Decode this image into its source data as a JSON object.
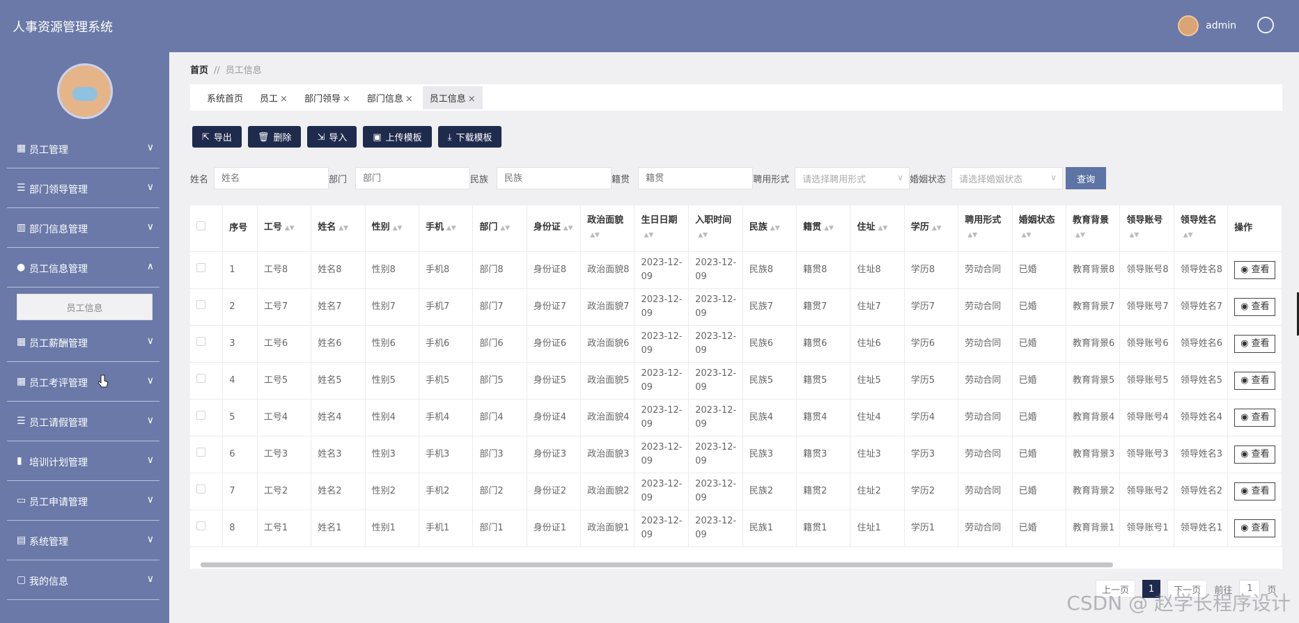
{
  "app": {
    "title": "人事资源管理系统",
    "user": "admin"
  },
  "sidebar": {
    "items": [
      {
        "label": "员工管理",
        "icon": "grid-icon"
      },
      {
        "label": "部门领导管理",
        "icon": "list-icon"
      },
      {
        "label": "部门信息管理",
        "icon": "columns-icon"
      },
      {
        "label": "员工信息管理",
        "icon": "location-icon",
        "expanded": true
      },
      {
        "label": "员工薪酬管理",
        "icon": "grid-icon"
      },
      {
        "label": "员工考评管理",
        "icon": "grid-icon"
      },
      {
        "label": "员工请假管理",
        "icon": "list-icon"
      },
      {
        "label": "培训计划管理",
        "icon": "bar-chart-icon"
      },
      {
        "label": "员工申请管理",
        "icon": "monitor-icon"
      },
      {
        "label": "系统管理",
        "icon": "clipboard-icon"
      },
      {
        "label": "我的信息",
        "icon": "card-icon"
      }
    ],
    "sub_item": "员工信息"
  },
  "breadcrumb": {
    "home": "首页",
    "sep": "//",
    "current": "员工信息"
  },
  "tabs": [
    {
      "label": "系统首页",
      "closable": false
    },
    {
      "label": "员工",
      "closable": true
    },
    {
      "label": "部门领导",
      "closable": true
    },
    {
      "label": "部门信息",
      "closable": true
    },
    {
      "label": "员工信息",
      "closable": true,
      "active": true
    }
  ],
  "toolbar": {
    "export": "导出",
    "delete": "删除",
    "import": "导入",
    "upload": "上传模板",
    "download": "下载模板"
  },
  "search": {
    "name_label": "姓名",
    "name_ph": "姓名",
    "dept_label": "部门",
    "dept_ph": "部门",
    "ethnic_label": "民族",
    "ethnic_ph": "民族",
    "native_label": "籍贯",
    "native_ph": "籍贯",
    "hire_label": "聘用形式",
    "hire_ph": "请选择聘用形式",
    "marital_label": "婚姻状态",
    "marital_ph": "请选择婚姻状态",
    "query": "查询"
  },
  "table": {
    "columns": [
      "序号",
      "工号",
      "姓名",
      "性别",
      "手机",
      "部门",
      "身份证",
      "政治面貌",
      "生日日期",
      "入职时间",
      "民族",
      "籍贯",
      "住址",
      "学历",
      "聘用形式",
      "婚姻状态",
      "教育背景",
      "领导账号",
      "领导姓名",
      "操作"
    ],
    "view_label": "查看",
    "rows": [
      [
        "1",
        "工号8",
        "姓名8",
        "性别8",
        "手机8",
        "部门8",
        "身份证8",
        "政治面貌8",
        "2023-12-09",
        "2023-12-09",
        "民族8",
        "籍贯8",
        "住址8",
        "学历8",
        "劳动合同",
        "已婚",
        "教育背景8",
        "领导账号8",
        "领导姓名8"
      ],
      [
        "2",
        "工号7",
        "姓名7",
        "性别7",
        "手机7",
        "部门7",
        "身份证7",
        "政治面貌7",
        "2023-12-09",
        "2023-12-09",
        "民族7",
        "籍贯7",
        "住址7",
        "学历7",
        "劳动合同",
        "已婚",
        "教育背景7",
        "领导账号7",
        "领导姓名7"
      ],
      [
        "3",
        "工号6",
        "姓名6",
        "性别6",
        "手机6",
        "部门6",
        "身份证6",
        "政治面貌6",
        "2023-12-09",
        "2023-12-09",
        "民族6",
        "籍贯6",
        "住址6",
        "学历6",
        "劳动合同",
        "已婚",
        "教育背景6",
        "领导账号6",
        "领导姓名6"
      ],
      [
        "4",
        "工号5",
        "姓名5",
        "性别5",
        "手机5",
        "部门5",
        "身份证5",
        "政治面貌5",
        "2023-12-09",
        "2023-12-09",
        "民族5",
        "籍贯5",
        "住址5",
        "学历5",
        "劳动合同",
        "已婚",
        "教育背景5",
        "领导账号5",
        "领导姓名5"
      ],
      [
        "5",
        "工号4",
        "姓名4",
        "性别4",
        "手机4",
        "部门4",
        "身份证4",
        "政治面貌4",
        "2023-12-09",
        "2023-12-09",
        "民族4",
        "籍贯4",
        "住址4",
        "学历4",
        "劳动合同",
        "已婚",
        "教育背景4",
        "领导账号4",
        "领导姓名4"
      ],
      [
        "6",
        "工号3",
        "姓名3",
        "性别3",
        "手机3",
        "部门3",
        "身份证3",
        "政治面貌3",
        "2023-12-09",
        "2023-12-09",
        "民族3",
        "籍贯3",
        "住址3",
        "学历3",
        "劳动合同",
        "已婚",
        "教育背景3",
        "领导账号3",
        "领导姓名3"
      ],
      [
        "7",
        "工号2",
        "姓名2",
        "性别2",
        "手机2",
        "部门2",
        "身份证2",
        "政治面貌2",
        "2023-12-09",
        "2023-12-09",
        "民族2",
        "籍贯2",
        "住址2",
        "学历2",
        "劳动合同",
        "已婚",
        "教育背景2",
        "领导账号2",
        "领导姓名2"
      ],
      [
        "8",
        "工号1",
        "姓名1",
        "性别1",
        "手机1",
        "部门1",
        "身份证1",
        "政治面貌1",
        "2023-12-09",
        "2023-12-09",
        "民族1",
        "籍贯1",
        "住址1",
        "学历1",
        "劳动合同",
        "已婚",
        "教育背景1",
        "领导账号1",
        "领导姓名1"
      ]
    ]
  },
  "pager": {
    "prev": "上一页",
    "page": "1",
    "next": "下一页",
    "goto": "前往",
    "goto_value": "1",
    "unit": "页"
  },
  "watermark": "CSDN @ 赵学长程序设计"
}
